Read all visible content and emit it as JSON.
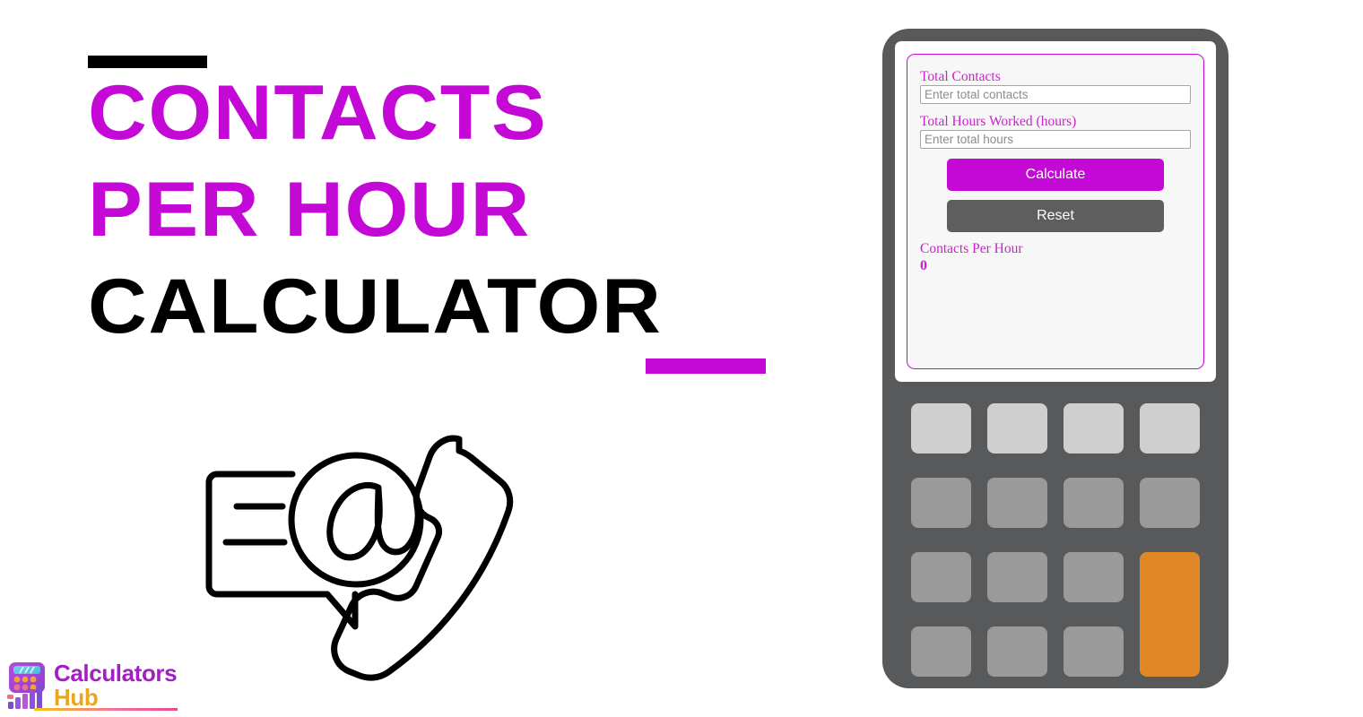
{
  "page": {
    "background": "#ffffff",
    "accent_magenta": "#c408d6",
    "accent_orange": "#e08828",
    "frame_gray": "#58595b"
  },
  "hero": {
    "line1": "CONTACTS",
    "line2": "PER HOUR",
    "line3": "CALCULATOR",
    "rule_top_color": "#000000",
    "rule_bottom_color": "#c408d6",
    "line1_color": "#c408d6",
    "line2_color": "#c408d6",
    "line3_color": "#000000"
  },
  "illustration": {
    "name": "contact-at-symbol-phone-illustration",
    "stroke_color": "#000000"
  },
  "logo": {
    "word1": "Calculators",
    "word2": "Hub",
    "word1_color": "#a31fc4",
    "word2_color": "#e8a71c"
  },
  "calculator": {
    "form": {
      "fields": [
        {
          "label": "Total Contacts",
          "placeholder": "Enter total contacts",
          "value": ""
        },
        {
          "label": "Total Hours Worked (hours)",
          "placeholder": "Enter total hours",
          "value": ""
        }
      ],
      "calculate_label": "Calculate",
      "reset_label": "Reset",
      "result_label": "Contacts Per Hour",
      "result_value": "0"
    },
    "keypad": {
      "rows": [
        [
          {
            "style": "light"
          },
          {
            "style": "light"
          },
          {
            "style": "light"
          },
          {
            "style": "light"
          }
        ],
        [
          {
            "style": "mid"
          },
          {
            "style": "mid"
          },
          {
            "style": "mid"
          },
          {
            "style": "mid"
          }
        ],
        [
          {
            "style": "mid"
          },
          {
            "style": "mid"
          },
          {
            "style": "mid"
          },
          {
            "style": "accent"
          }
        ],
        [
          {
            "style": "mid"
          },
          {
            "style": "mid"
          },
          {
            "style": "mid"
          }
        ]
      ]
    }
  }
}
